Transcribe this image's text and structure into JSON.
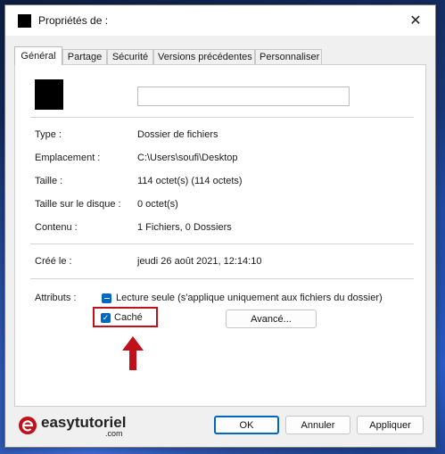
{
  "window": {
    "title": "Propriétés de :",
    "close_glyph": "✕"
  },
  "tabs": [
    {
      "label": "Général",
      "active": true
    },
    {
      "label": "Partage"
    },
    {
      "label": "Sécurité"
    },
    {
      "label": "Versions précédentes"
    },
    {
      "label": "Personnaliser"
    }
  ],
  "name_field": {
    "value": ""
  },
  "info": {
    "type_label": "Type :",
    "type_value": "Dossier de fichiers",
    "location_label": "Emplacement :",
    "location_value": "C:\\Users\\soufi\\Desktop",
    "size_label": "Taille :",
    "size_value": "114 octet(s) (114 octets)",
    "disk_size_label": "Taille sur le disque :",
    "disk_size_value": "0 octet(s)",
    "contents_label": "Contenu :",
    "contents_value": "1 Fichiers, 0 Dossiers",
    "created_label": "Créé le :",
    "created_value": "jeudi 26 août 2021, 12:14:10"
  },
  "attributes": {
    "label": "Attributs :",
    "readonly_label": "Lecture seule (s'applique uniquement aux fichiers du dossier)",
    "readonly_state": "indeterminate",
    "hidden_label": "Caché",
    "hidden_checked": true,
    "advanced_label": "Avancé..."
  },
  "buttons": {
    "ok": "OK",
    "cancel": "Annuler",
    "apply": "Appliquer"
  },
  "watermark": {
    "text": "easytutoriel",
    "sub": ".com"
  },
  "colors": {
    "accent": "#0067c0",
    "highlight": "#c0111b"
  }
}
